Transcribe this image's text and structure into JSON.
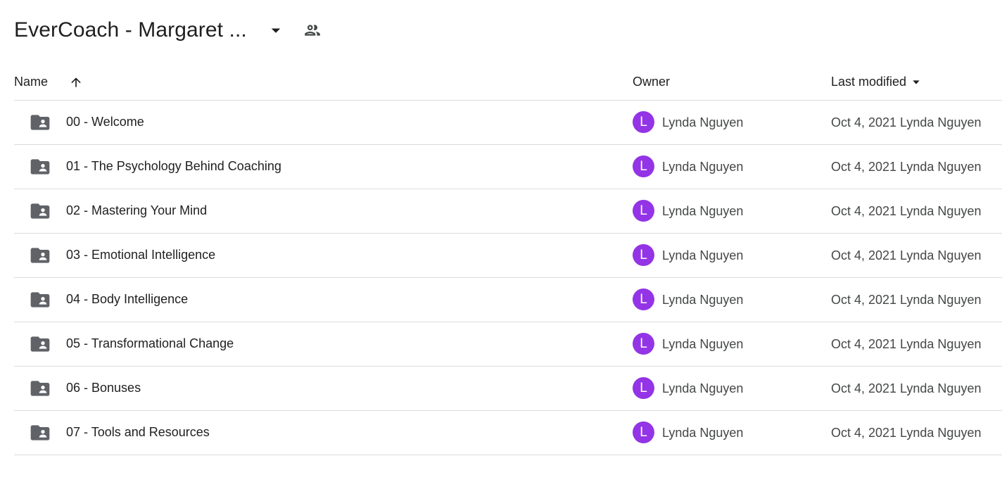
{
  "folder": {
    "title": "EverCoach - Margaret ...",
    "dropdown_icon": "caret-down-icon",
    "shared_icon": "people-icon"
  },
  "columns": {
    "name": "Name",
    "owner": "Owner",
    "last_modified": "Last modified",
    "name_sort_icon": "arrow-up-icon",
    "modified_sort_icon": "caret-down-icon"
  },
  "colors": {
    "avatar_bg": "#9334e6",
    "divider": "#dadce0",
    "icon": "#5f6368"
  },
  "rows": [
    {
      "name": "00 - Welcome",
      "icon": "shared-folder-icon",
      "owner_initial": "L",
      "owner": "Lynda Nguyen",
      "modified": "Oct 4, 2021 Lynda Nguyen"
    },
    {
      "name": "01 - The Psychology Behind Coaching",
      "icon": "shared-folder-icon",
      "owner_initial": "L",
      "owner": "Lynda Nguyen",
      "modified": "Oct 4, 2021 Lynda Nguyen"
    },
    {
      "name": "02 - Mastering Your Mind",
      "icon": "shared-folder-icon",
      "owner_initial": "L",
      "owner": "Lynda Nguyen",
      "modified": "Oct 4, 2021 Lynda Nguyen"
    },
    {
      "name": "03 - Emotional Intelligence",
      "icon": "shared-folder-icon",
      "owner_initial": "L",
      "owner": "Lynda Nguyen",
      "modified": "Oct 4, 2021 Lynda Nguyen"
    },
    {
      "name": "04 - Body Intelligence",
      "icon": "shared-folder-icon",
      "owner_initial": "L",
      "owner": "Lynda Nguyen",
      "modified": "Oct 4, 2021 Lynda Nguyen"
    },
    {
      "name": "05 - Transformational Change",
      "icon": "shared-folder-icon",
      "owner_initial": "L",
      "owner": "Lynda Nguyen",
      "modified": "Oct 4, 2021 Lynda Nguyen"
    },
    {
      "name": "06 - Bonuses",
      "icon": "shared-folder-icon",
      "owner_initial": "L",
      "owner": "Lynda Nguyen",
      "modified": "Oct 4, 2021 Lynda Nguyen"
    },
    {
      "name": "07 - Tools and Resources",
      "icon": "shared-folder-icon",
      "owner_initial": "L",
      "owner": "Lynda Nguyen",
      "modified": "Oct 4, 2021 Lynda Nguyen"
    }
  ]
}
